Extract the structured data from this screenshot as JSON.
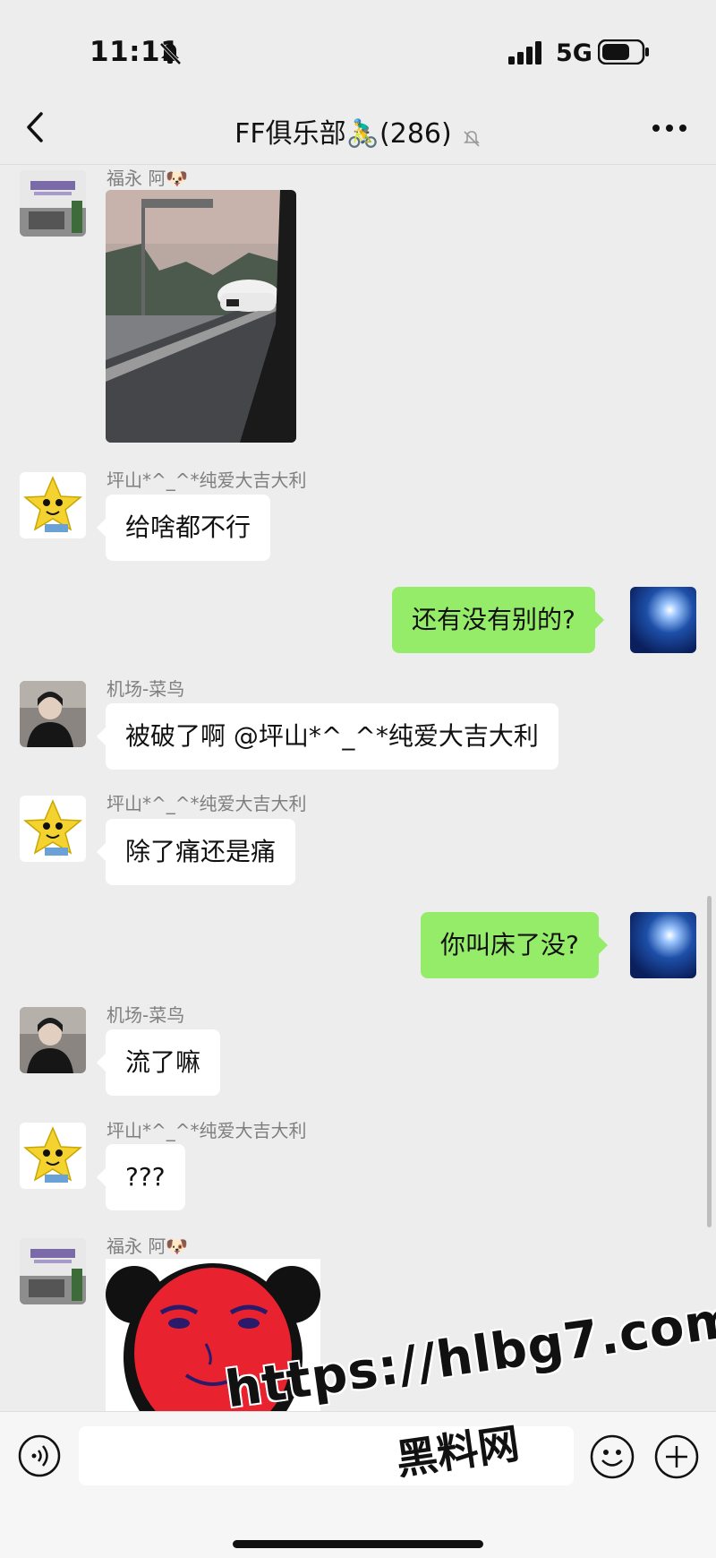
{
  "status_bar": {
    "time": "11:11",
    "network": "5G"
  },
  "nav": {
    "title": "FF俱乐部🚴‍♂️(286)"
  },
  "messages": [
    {
      "sender": "福永 阿🐶",
      "type": "image",
      "description_icon": "car-photo"
    },
    {
      "sender": "坪山*^_^*纯爱大吉大利",
      "text": "给啥都不行"
    },
    {
      "text": "还有没有别的?"
    },
    {
      "sender": "机场-菜鸟",
      "text": "被破了啊 @坪山*^_^*纯爱大吉大利"
    },
    {
      "sender": "坪山*^_^*纯爱大吉大利",
      "text": "除了痛还是痛"
    },
    {
      "text": "你叫床了没?"
    },
    {
      "sender": "机场-菜鸟",
      "text": "流了嘛"
    },
    {
      "sender": "坪山*^_^*纯爱大吉大利",
      "text": "???"
    },
    {
      "sender": "福永 阿🐶",
      "type": "image",
      "description_icon": "panda-meme"
    }
  ],
  "watermark": {
    "url": "https://hlbg7.com",
    "text": "黑料网"
  },
  "icons": {
    "back": "chevron-left-icon",
    "mute": "bell-off-icon",
    "more": "more-dots-icon",
    "voice": "voice-icon",
    "emoji": "emoji-icon",
    "plus": "plus-icon"
  },
  "colors": {
    "self_bubble": "#95ec69",
    "other_bubble": "#ffffff",
    "background": "#ededed"
  }
}
